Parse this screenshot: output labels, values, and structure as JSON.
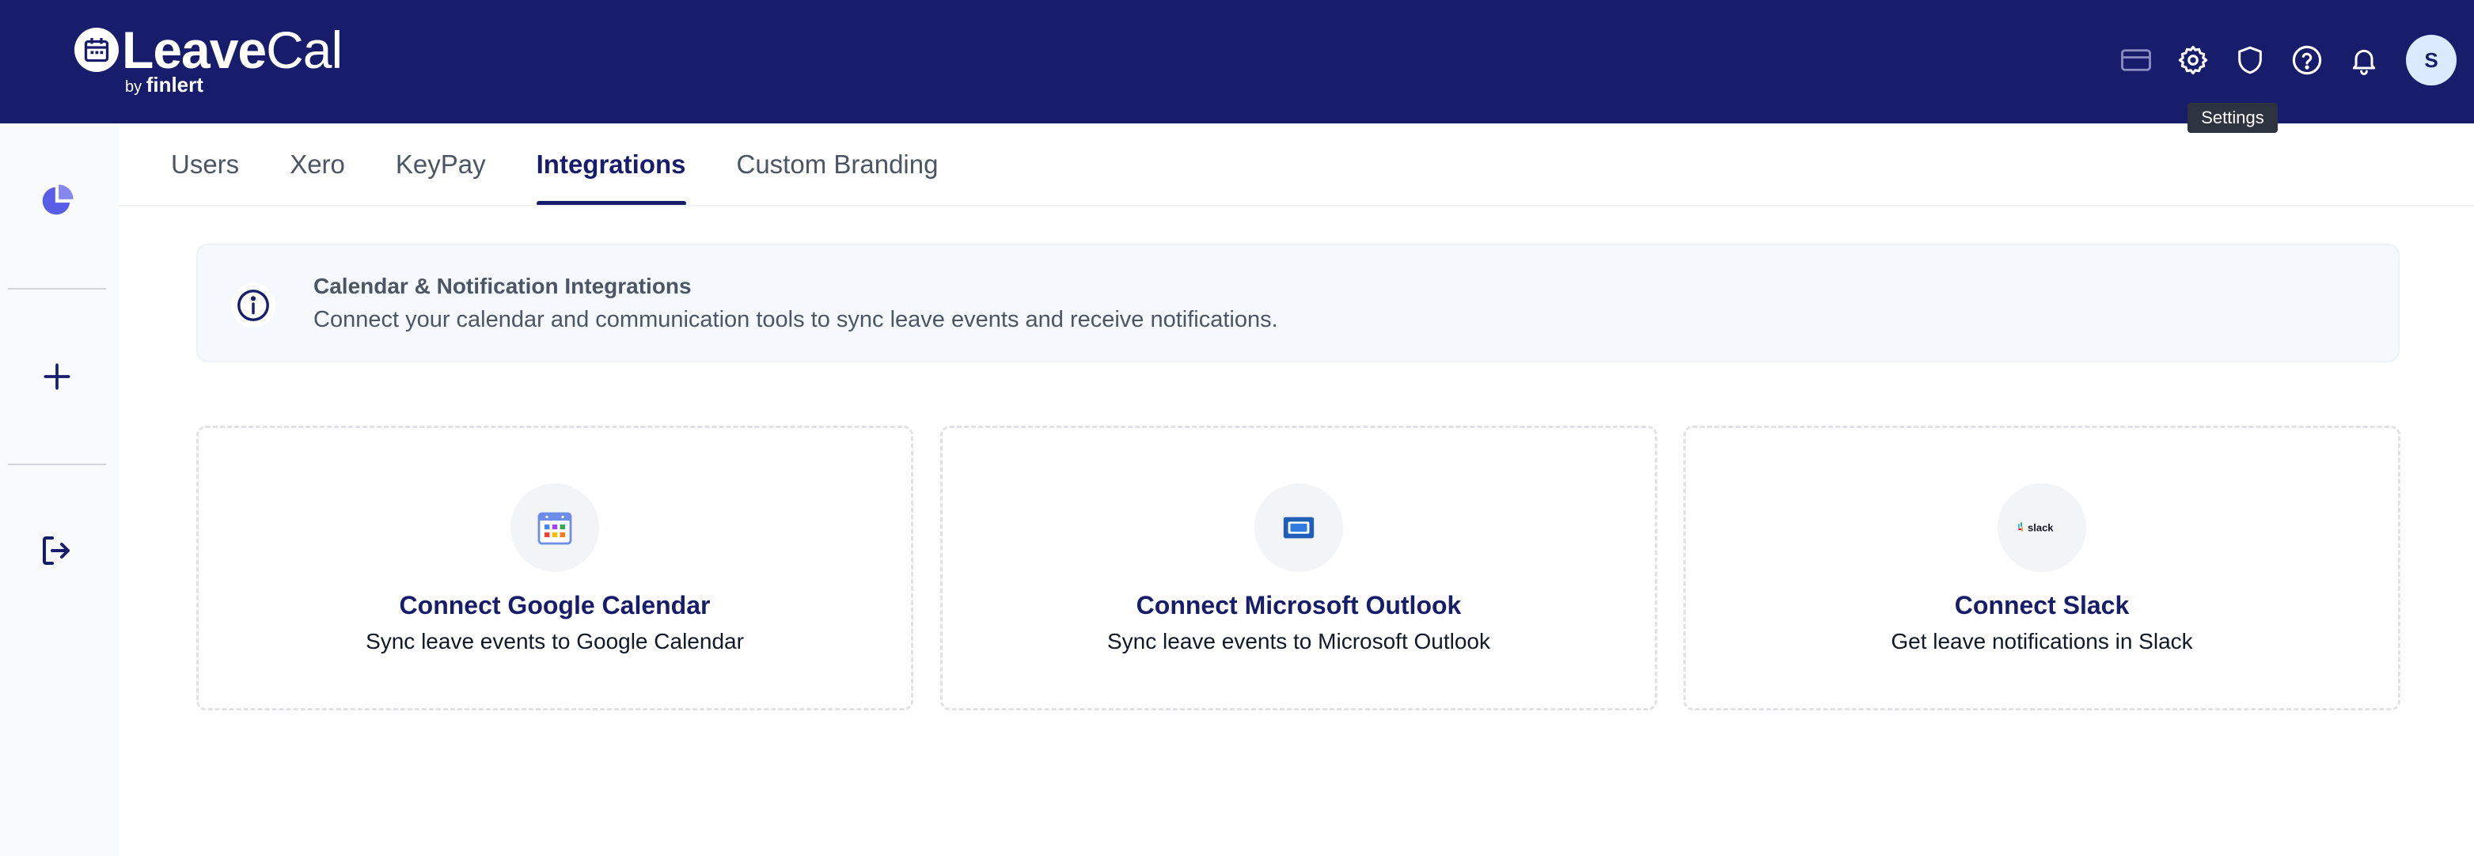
{
  "app": {
    "logo_primary": "Leave",
    "logo_secondary": "Cal",
    "logo_by": "by",
    "logo_company": "finlert"
  },
  "header": {
    "icons": [
      "billing-card-icon",
      "settings-gear-icon",
      "shield-icon",
      "help-icon",
      "bell-icon"
    ],
    "avatar_initial": "S",
    "tooltip": "Settings"
  },
  "sidebar": {
    "items": [
      "pie-chart-icon",
      "plus-icon",
      "logout-icon"
    ]
  },
  "tabs": [
    {
      "label": "Users",
      "active": false
    },
    {
      "label": "Xero",
      "active": false
    },
    {
      "label": "KeyPay",
      "active": false
    },
    {
      "label": "Integrations",
      "active": true
    },
    {
      "label": "Custom Branding",
      "active": false
    }
  ],
  "info_banner": {
    "title": "Calendar & Notification Integrations",
    "description": "Connect your calendar and communication tools to sync leave events and receive notifications."
  },
  "integrations": [
    {
      "icon": "google-calendar-icon",
      "title": "Connect Google Calendar",
      "description": "Sync leave events to Google Calendar"
    },
    {
      "icon": "outlook-icon",
      "title": "Connect Microsoft Outlook",
      "description": "Sync leave events to Microsoft Outlook"
    },
    {
      "icon": "slack-icon",
      "title": "Connect Slack",
      "description": "Get leave notifications in Slack",
      "icon_text": "slack"
    }
  ],
  "colors": {
    "header_bg": "#171c6b",
    "accent": "#171c6b",
    "sidebar_accent": "#5a5de6"
  }
}
